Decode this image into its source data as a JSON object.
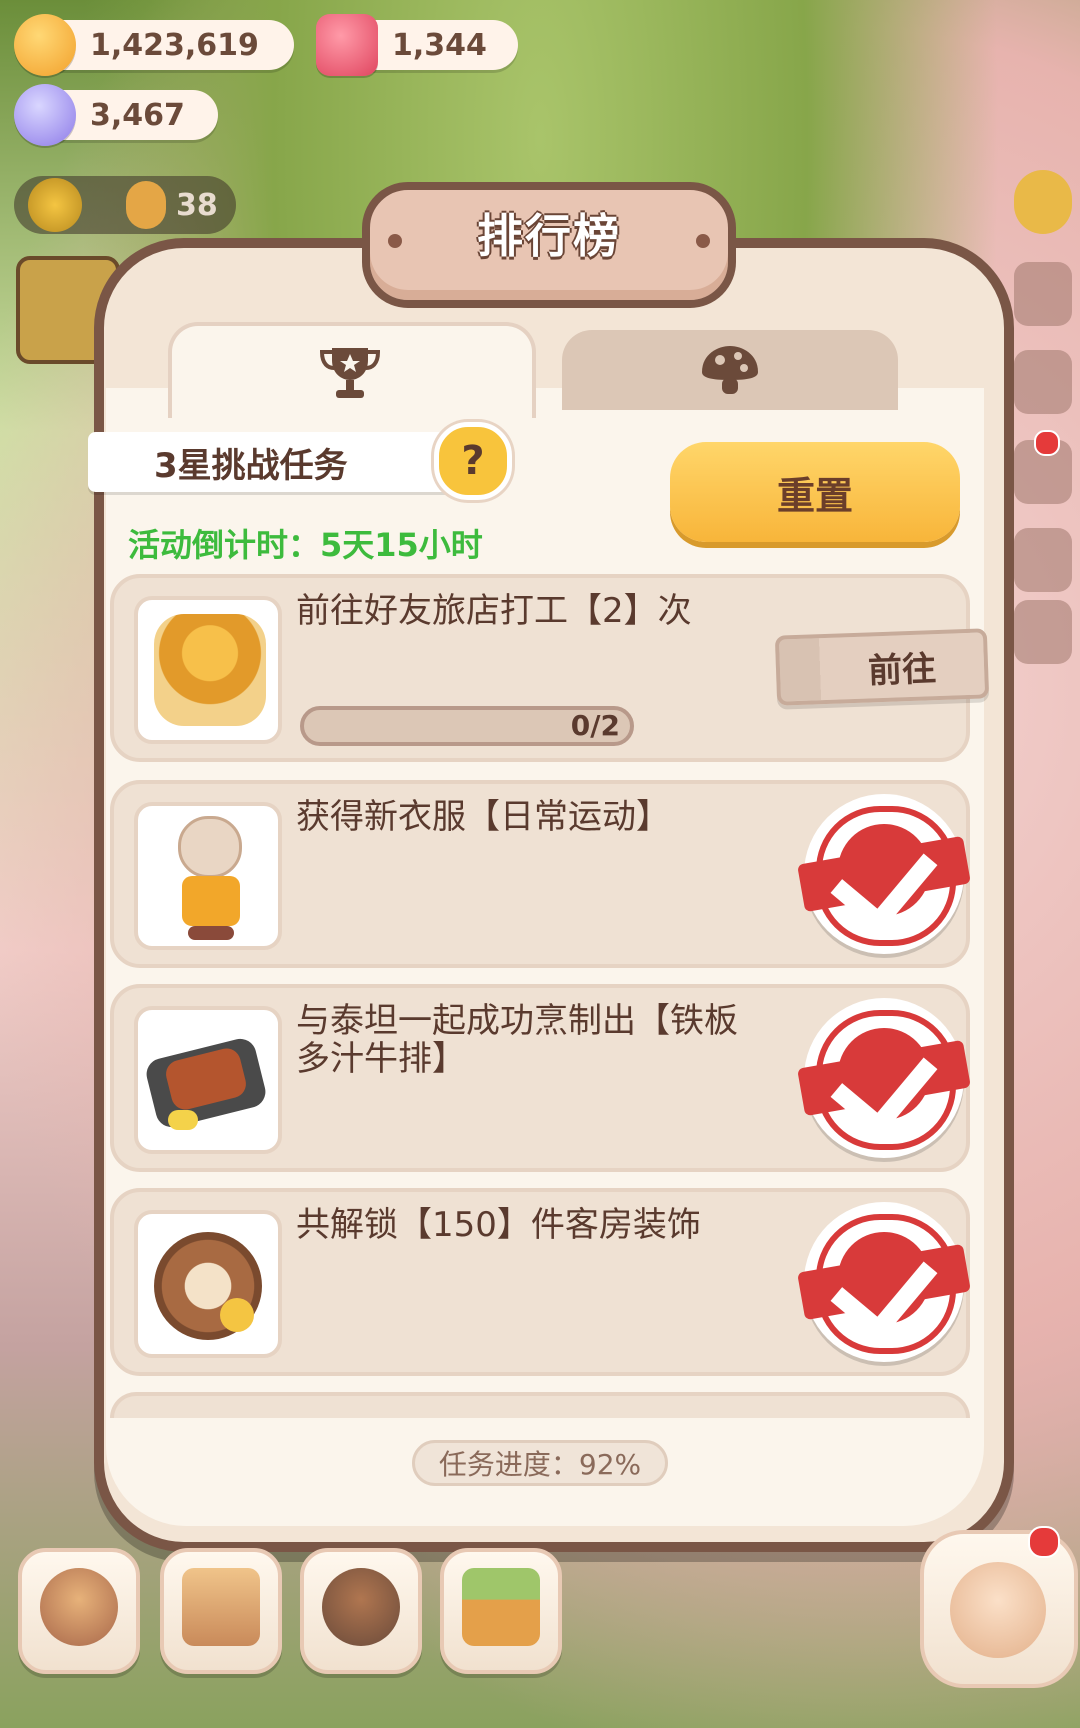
{
  "currencies": {
    "coins": {
      "value": "1,423,619",
      "icon": "cookie-coin-icon"
    },
    "red_gems": {
      "value": "1,344",
      "icon": "red-gem-icon"
    },
    "purple_gems": {
      "value": "3,467",
      "icon": "purple-gem-icon"
    }
  },
  "level": {
    "value": "38"
  },
  "modal": {
    "title": "排行榜",
    "tabs": [
      {
        "icon": "trophy-icon",
        "active": true
      },
      {
        "icon": "mushroom-icon",
        "active": false
      }
    ],
    "task_header": {
      "label": "3星挑战任务",
      "help": "?"
    },
    "countdown": "活动倒计时：5天15小时",
    "reset_label": "重置",
    "tasks": [
      {
        "text": "前往好友旅店打工【2】次",
        "progress": "0/2",
        "action": "前往",
        "completed": false
      },
      {
        "text": "获得新衣服【日常运动】",
        "completed": true
      },
      {
        "text": "与泰坦一起成功烹制出【铁板多汁牛排】",
        "completed": true
      },
      {
        "text": "共解锁【150】件客房装饰",
        "completed": true
      }
    ],
    "footer": "任务进度：92%"
  },
  "colors": {
    "accent_yellow": "#f8b53a",
    "countdown_green": "#3dbb3d",
    "stamp_red": "#d83a3a",
    "frame_brown": "#7a5646"
  }
}
